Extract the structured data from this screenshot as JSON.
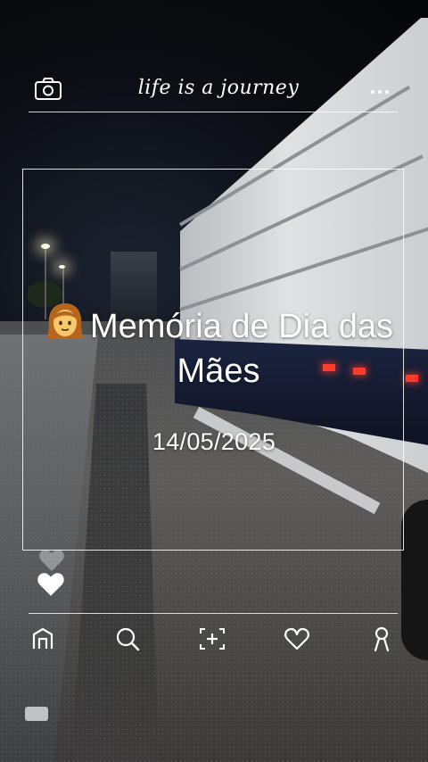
{
  "header": {
    "camera_icon": "camera-icon",
    "brand_text": "life is a journey",
    "more_icon": "more-dots-icon"
  },
  "post": {
    "emoji": "woman-emoji",
    "title": "Memória de Dia das Mães",
    "date": "14/05/2025"
  },
  "actions": {
    "like_icon": "heart-icon"
  },
  "bottom_nav": {
    "items": [
      {
        "name": "home",
        "icon": "home-icon"
      },
      {
        "name": "search",
        "icon": "search-icon"
      },
      {
        "name": "add",
        "icon": "add-photo-icon"
      },
      {
        "name": "likes",
        "icon": "heart-outline-icon"
      },
      {
        "name": "profile",
        "icon": "profile-icon"
      }
    ]
  },
  "colors": {
    "overlay_text": "#ffffff",
    "tail_light": "#ff3b2e"
  }
}
